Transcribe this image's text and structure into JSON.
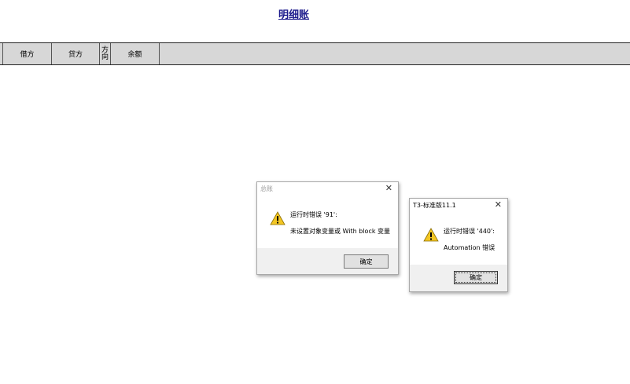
{
  "report": {
    "title": "明细账"
  },
  "table_header": {
    "columns": [
      "借方",
      "贷方",
      "方向",
      "余额"
    ],
    "direction_chars": [
      "方",
      "向"
    ]
  },
  "dialog_ledger": {
    "title": "总账",
    "close_glyph": "✕",
    "error_line": "运行时错误 '91':",
    "detail_line": "未设置对象变量或 With block 变量",
    "ok_label": "确定"
  },
  "dialog_t3": {
    "title": "T3-标准版11.1",
    "close_glyph": "✕",
    "error_line": "运行时错误 '440':",
    "detail_line": "Automation 错误",
    "ok_label": "确定"
  },
  "colors": {
    "title_link": "#1c1a8c",
    "header_bg": "#d7d7d7",
    "warning_yellow": "#f3c623",
    "dialog_footer": "#f0f0f0"
  },
  "icons": {
    "warning": "warning-icon",
    "close": "close-icon"
  }
}
